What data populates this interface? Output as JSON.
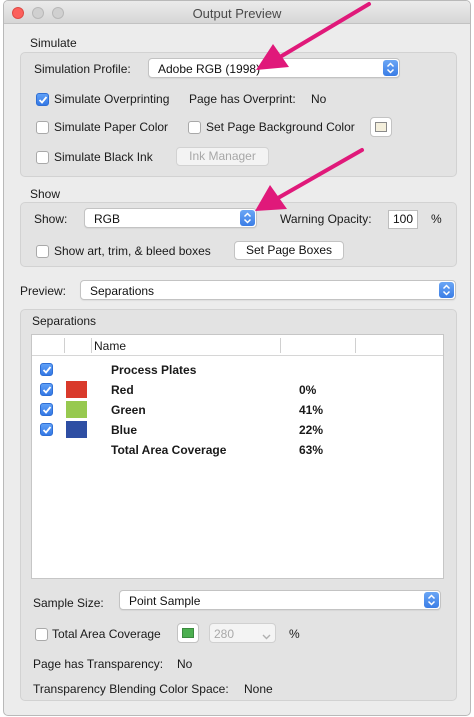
{
  "window": {
    "title": "Output Preview"
  },
  "simulate": {
    "header": "Simulate",
    "profile_label": "Simulation Profile:",
    "profile_value": "Adobe RGB (1998)",
    "overprinting_label": "Simulate Overprinting",
    "overprinting_checked": true,
    "page_overprint_label": "Page has Overprint:",
    "page_overprint_value": "No",
    "paper_color_label": "Simulate Paper Color",
    "paper_color_checked": false,
    "page_bg_label": "Set Page Background Color",
    "page_bg_checked": false,
    "black_ink_label": "Simulate Black Ink",
    "black_ink_checked": false,
    "ink_manager_label": "Ink Manager"
  },
  "show": {
    "header": "Show",
    "show_label": "Show:",
    "show_value": "RGB",
    "warning_label": "Warning Opacity:",
    "warning_value": "100",
    "warning_unit": "%",
    "boxes_label": "Show art, trim, & bleed boxes",
    "boxes_checked": false,
    "set_boxes_label": "Set Page Boxes"
  },
  "preview": {
    "label": "Preview:",
    "value": "Separations"
  },
  "separations": {
    "header": "Separations",
    "col_name": "Name",
    "rows": [
      {
        "name": "Process Plates",
        "pct": "",
        "checked": true,
        "color": ""
      },
      {
        "name": "Red",
        "pct": "0%",
        "checked": true,
        "color": "#d93a2b"
      },
      {
        "name": "Green",
        "pct": "41%",
        "checked": true,
        "color": "#97c94f"
      },
      {
        "name": "Blue",
        "pct": "22%",
        "checked": true,
        "color": "#2e4ea3"
      },
      {
        "name": "Total Area Coverage",
        "pct": "63%",
        "checked": false,
        "color": ""
      }
    ]
  },
  "bottom": {
    "sample_size_label": "Sample Size:",
    "sample_size_value": "Point Sample",
    "tac_label": "Total Area Coverage",
    "tac_checked": false,
    "tac_value": "280",
    "tac_unit": "%",
    "tac_color": "#4caf50",
    "transparency_label": "Page has Transparency:",
    "transparency_value": "No",
    "blending_label": "Transparency Blending Color Space:",
    "blending_value": "None"
  },
  "colors": {
    "accent": "#3a7de6",
    "annotation_arrow": "#e0197a"
  }
}
